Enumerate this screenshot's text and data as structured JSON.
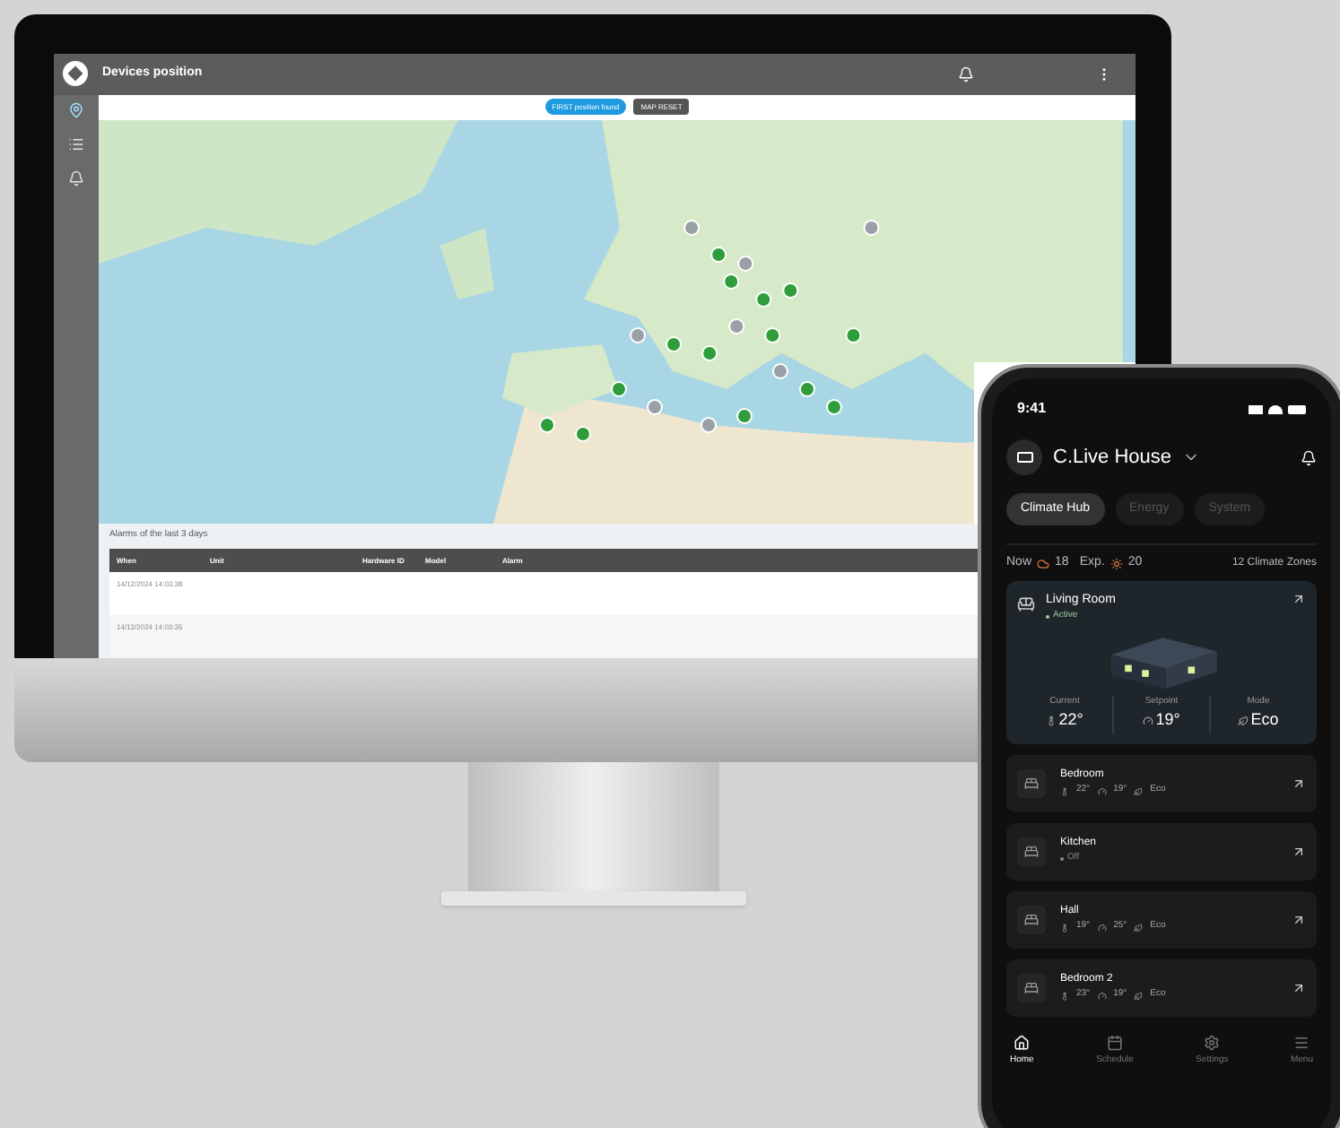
{
  "desktop_app": {
    "title": "Devices position",
    "toolbar": [
      {
        "label": "FIRST position found",
        "selected": true
      },
      {
        "label": "MAP RESET",
        "selected": false
      }
    ],
    "sidebar": [
      {
        "selected": true
      },
      {
        "selected": false
      },
      {
        "selected": false
      }
    ],
    "alarms": {
      "title": "Alarms of the last 3 days",
      "columns": [
        "When",
        "Unit",
        "Hardware ID",
        "Model",
        "Alarm"
      ],
      "rows": [
        [
          "14/12/2024 14:03:38"
        ],
        [
          "14/12/2024 14:03:35"
        ]
      ]
    }
  },
  "phone_app": {
    "status_time": "9:41",
    "home_name": "C.Live House",
    "tabs": [
      {
        "label": "Climate Hub",
        "selected": true
      },
      {
        "label": "Energy",
        "selected": false
      },
      {
        "label": "System",
        "selected": false
      }
    ],
    "summary": {
      "now_label": "Now",
      "now_value": "18",
      "expected_label": "Exp.",
      "expected_value": "20",
      "zones": "12 Climate Zones"
    },
    "featured_room": {
      "name": "Living Room",
      "status": "Active",
      "stats": [
        {
          "label": "Current",
          "value": "22°"
        },
        {
          "label": "Setpoint",
          "value": "19°"
        },
        {
          "label": "Mode",
          "value": "Eco"
        }
      ]
    },
    "rooms": [
      {
        "kind": "active",
        "name": "Bedroom",
        "current": "22°",
        "setpoint": "19°",
        "mode": "Eco"
      },
      {
        "kind": "off",
        "name": "Kitchen",
        "status": "Off"
      },
      {
        "kind": "active",
        "name": "Hall",
        "current": "19°",
        "setpoint": "25°",
        "mode": "Eco"
      },
      {
        "kind": "active",
        "name": "Bedroom 2",
        "current": "23°",
        "setpoint": "19°",
        "mode": "Eco"
      }
    ],
    "nav": [
      {
        "label": "Home",
        "selected": true
      },
      {
        "label": "Schedule",
        "selected": false
      },
      {
        "label": "Settings",
        "selected": false
      },
      {
        "label": "Menu",
        "selected": false
      }
    ]
  }
}
